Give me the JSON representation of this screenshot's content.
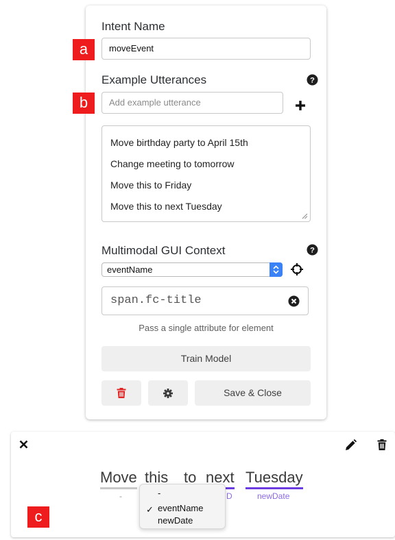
{
  "markers": [
    "a",
    "b",
    "c"
  ],
  "intent": {
    "name_label": "Intent Name",
    "name_value": "moveEvent"
  },
  "utterances": {
    "label": "Example Utterances",
    "input_placeholder": "Add example utterance",
    "items": [
      "Move birthday party to April 15th",
      "Change meeting to tomorrow",
      "Move this to Friday",
      "Move this to next Tuesday"
    ]
  },
  "gui_context": {
    "label": "Multimodal GUI Context",
    "selected_attribute": "eventName",
    "selector_value": "span.fc-title",
    "hint": "Pass a single attribute for element"
  },
  "buttons": {
    "train": "Train Model",
    "save_close": "Save & Close"
  },
  "icons": {
    "help": "question-circle-icon",
    "add": "plus-icon",
    "crosshair": "crosshair-icon",
    "clear": "times-circle-icon",
    "delete": "trash-icon",
    "settings": "gear-icon",
    "close": "close-icon",
    "edit": "pencil-icon"
  },
  "colors": {
    "marker": "#ee1c1c",
    "delete": "#e02424",
    "entity_underline": "#6c3ce0",
    "select_accent": "#3b82f6"
  },
  "annotation": {
    "words": [
      {
        "text": "Move",
        "tag": "-"
      },
      {
        "text": "this",
        "tag": ""
      },
      {
        "text": "to",
        "tag": ""
      },
      {
        "text": "next",
        "tag": "...D"
      },
      {
        "text": "Tuesday",
        "tag": "newDate"
      }
    ],
    "visible_tags": [
      "-",
      "D",
      "newDate"
    ],
    "dropdown_options": [
      "-",
      "eventName",
      "newDate"
    ],
    "dropdown_checked": "eventName"
  }
}
